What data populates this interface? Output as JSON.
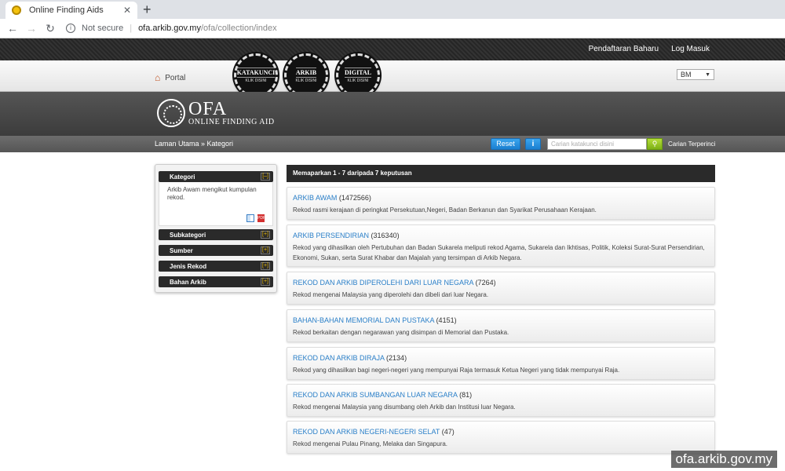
{
  "browser": {
    "tab_title": "Online Finding Aids",
    "tab_close": "✕",
    "new_tab": "+",
    "security_label": "Not secure",
    "url_host": "ofa.arkib.gov.my",
    "url_path": "/ofa/collection/index"
  },
  "header": {
    "register_label": "Pendaftaran Baharu",
    "login_label": "Log Masuk",
    "portal_label": "Portal",
    "language": "BM",
    "circle_buttons": [
      {
        "label": "KATAKUNCI",
        "sub": "KLIK DISINI"
      },
      {
        "label": "ARKIB",
        "sub": "KLIK DISINI"
      },
      {
        "label": "DIGITAL",
        "sub": "KLIK DISINI"
      }
    ],
    "logo_title": "OFA",
    "logo_subtitle": "ONLINE FINDING AID"
  },
  "toolbar": {
    "breadcrumb": "Laman Utama » Kategori",
    "reset_label": "Reset",
    "info_label": "i",
    "search_placeholder": "Carian katakunci disini",
    "advanced_search_label": "Carian Terperinci"
  },
  "sidebar": {
    "panels": [
      {
        "title": "Kategori",
        "toggle": "[–]",
        "body": "Arkib Awam mengikut kumpulan rekod."
      },
      {
        "title": "Subkategori",
        "toggle": "[+]"
      },
      {
        "title": "Sumber",
        "toggle": "[+]"
      },
      {
        "title": "Jenis Rekod",
        "toggle": "[+]"
      },
      {
        "title": "Bahan Arkib",
        "toggle": "[+]"
      }
    ]
  },
  "results": {
    "summary": "Memaparkan 1 - 7 daripada 7 keputusan",
    "items": [
      {
        "title": "ARKIB AWAM",
        "count": "(1472566)",
        "desc": "Rekod rasmi kerajaan di peringkat Persekutuan,Negeri, Badan Berkanun dan Syarikat Perusahaan Kerajaan."
      },
      {
        "title": "ARKIB PERSENDIRIAN",
        "count": "(316340)",
        "desc": "Rekod yang dihasilkan oleh Pertubuhan dan Badan Sukarela meliputi rekod Agama, Sukarela dan Ikhtisas, Politik, Koleksi Surat-Surat Persendirian, Ekonomi, Sukan, serta Surat Khabar dan Majalah yang tersimpan di Arkib Negara."
      },
      {
        "title": "REKOD DAN ARKIB DIPEROLEHI DARI LUAR NEGARA",
        "count": "(7264)",
        "desc": "Rekod mengenai Malaysia yang diperolehi dan dibeli dari luar Negara."
      },
      {
        "title": "BAHAN-BAHAN MEMORIAL DAN PUSTAKA",
        "count": "(4151)",
        "desc": "Rekod berkaitan dengan negarawan yang disimpan di Memorial dan Pustaka."
      },
      {
        "title": "REKOD DAN ARKIB DIRAJA",
        "count": "(2134)",
        "desc": "Rekod yang dihasilkan bagi negeri-negeri yang mempunyai Raja termasuk Ketua Negeri yang tidak mempunyai Raja."
      },
      {
        "title": "REKOD DAN ARKIB SUMBANGAN LUAR NEGARA",
        "count": "(81)",
        "desc": "Rekod mengenai Malaysia yang disumbang oleh Arkib dan Institusi luar Negara."
      },
      {
        "title": "REKOD DAN ARKIB NEGERI-NEGERI SELAT",
        "count": "(47)",
        "desc": "Rekod mengenai Pulau Pinang, Melaka dan Singapura."
      }
    ]
  },
  "watermark": "ofa.arkib.gov.my"
}
